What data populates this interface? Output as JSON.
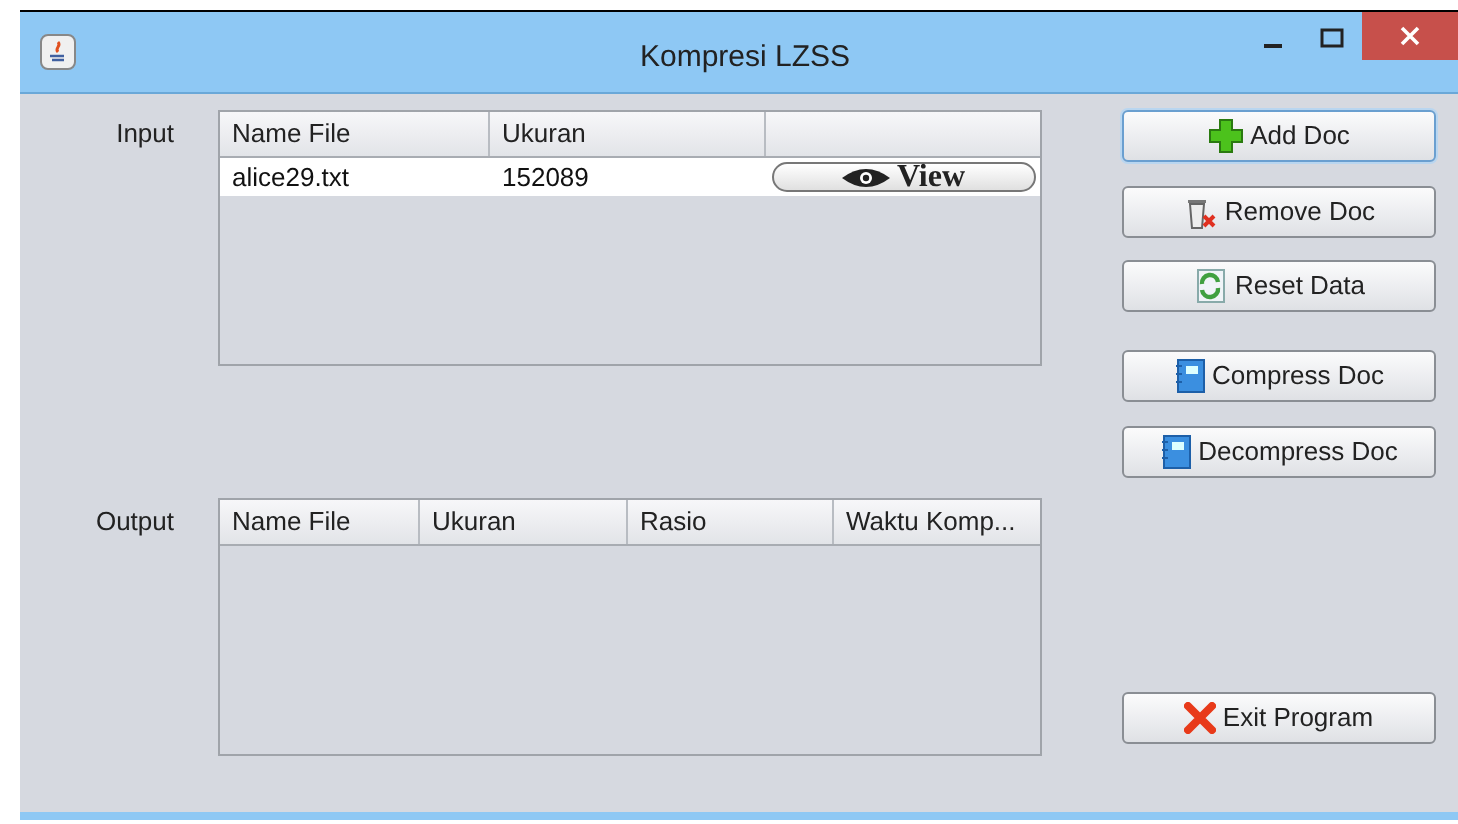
{
  "window": {
    "title": "Kompresi LZSS"
  },
  "input": {
    "label": "Input",
    "columns": [
      "Name File",
      "Ukuran",
      ""
    ],
    "rows": [
      {
        "name": "alice29.txt",
        "size": "152089",
        "action": "View"
      }
    ]
  },
  "output": {
    "label": "Output",
    "columns": [
      "Name File",
      "Ukuran",
      "Rasio",
      "Waktu Komp..."
    ]
  },
  "buttons": [
    {
      "label": "Add Doc",
      "kind": "add",
      "focused": true
    },
    {
      "label": "Remove Doc",
      "kind": "remove",
      "focused": false
    },
    {
      "label": "Reset Data",
      "kind": "reset",
      "focused": false
    },
    {
      "label": "Compress Doc",
      "kind": "compress",
      "focused": false
    },
    {
      "label": "Decompress Doc",
      "kind": "decompress",
      "focused": false
    },
    {
      "label": "Exit Program",
      "kind": "exit",
      "focused": false
    }
  ]
}
